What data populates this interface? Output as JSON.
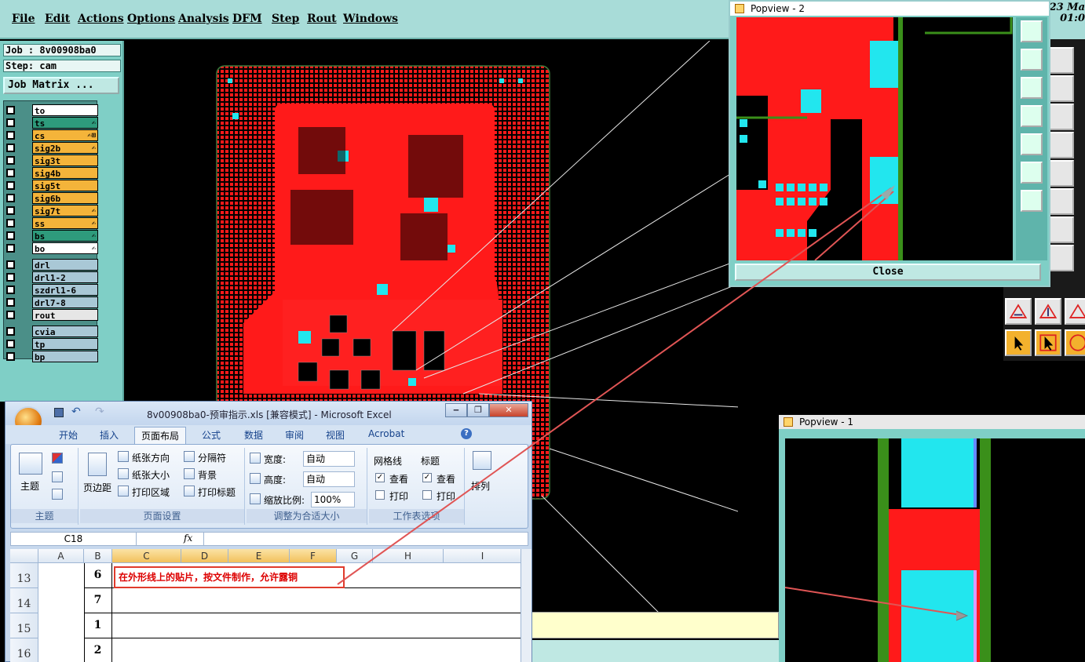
{
  "menubar": {
    "items": [
      "File",
      "Edit",
      "Actions",
      "Options",
      "Analysis",
      "DFM",
      "Step",
      "Rout",
      "Windows"
    ],
    "clock_line1": "23 Ma",
    "clock_line2": "01:0"
  },
  "job": {
    "job_label": "Job : 8v00908ba0",
    "step_label": "Step: cam",
    "matrix_button": "Job Matrix ..."
  },
  "layers": [
    {
      "name": "to",
      "color": "#ffffff",
      "flag": ""
    },
    {
      "name": "ts",
      "color": "#2e9b7c",
      "flag": "✍"
    },
    {
      "name": "cs",
      "color": "#f4b43a",
      "flag": "✍⊞"
    },
    {
      "name": "sig2b",
      "color": "#f4b43a",
      "flag": "✍"
    },
    {
      "name": "sig3t",
      "color": "#f4b43a",
      "flag": ""
    },
    {
      "name": "sig4b",
      "color": "#f4b43a",
      "flag": ""
    },
    {
      "name": "sig5t",
      "color": "#f4b43a",
      "flag": ""
    },
    {
      "name": "sig6b",
      "color": "#f4b43a",
      "flag": ""
    },
    {
      "name": "sig7t",
      "color": "#f4b43a",
      "flag": "✍"
    },
    {
      "name": "ss",
      "color": "#f4b43a",
      "flag": "✍"
    },
    {
      "name": "bs",
      "color": "#2e9b7c",
      "flag": "✍"
    },
    {
      "name": "bo",
      "color": "#ffffff",
      "flag": "✍"
    }
  ],
  "drill_layers": [
    {
      "name": "drl",
      "color": "#a9c8d6"
    },
    {
      "name": "drl1-2",
      "color": "#a9c8d6"
    },
    {
      "name": "szdrl1-6",
      "color": "#a9c8d6"
    },
    {
      "name": "drl7-8",
      "color": "#a9c8d6"
    },
    {
      "name": "rout",
      "color": "#e6e6e6"
    }
  ],
  "misc_layers": [
    {
      "name": "cvia",
      "color": "#a9c8d6"
    },
    {
      "name": "tp",
      "color": "#a9c8d6"
    },
    {
      "name": "bp",
      "color": "#a9c8d6"
    }
  ],
  "popview2": {
    "title": "Popview - 2",
    "close_label": "Close"
  },
  "popview1": {
    "title": "Popview - 1"
  },
  "excel": {
    "title": "8v00908ba0-预审指示.xls  [兼容模式] - Microsoft Excel",
    "tabs": [
      "开始",
      "插入",
      "页面布局",
      "公式",
      "数据",
      "审阅",
      "视图",
      "Acrobat"
    ],
    "active_tab": "页面布局",
    "ribbon": {
      "theme_group": {
        "label": "主题",
        "button": "主题"
      },
      "page_setup": {
        "label": "页面设置",
        "margins": "页边距",
        "orientation": "纸张方向",
        "size": "纸张大小",
        "print_area": "打印区域",
        "breaks": "分隔符",
        "background": "背景",
        "print_titles": "打印标题"
      },
      "scale_fit": {
        "label": "调整为合适大小",
        "width_label": "宽度:",
        "width_value": "自动",
        "height_label": "高度:",
        "height_value": "自动",
        "scale_label": "缩放比例:",
        "scale_value": "100%"
      },
      "sheet_options": {
        "label": "工作表选项",
        "gridlines": "网格线",
        "headings": "标题",
        "view": "查看",
        "print": "打印"
      },
      "arrange": {
        "label": "排列"
      }
    },
    "name_box": "C18",
    "fx": "fx",
    "columns": [
      "A",
      "B",
      "C",
      "D",
      "E",
      "F",
      "G",
      "H",
      "I"
    ],
    "rows": [
      {
        "num": "13",
        "b": "6"
      },
      {
        "num": "14",
        "b": "7"
      },
      {
        "num": "15",
        "b": "1"
      },
      {
        "num": "16",
        "b": "2"
      }
    ],
    "note": "在外形线上的贴片，按文件制作，允许露铜"
  }
}
